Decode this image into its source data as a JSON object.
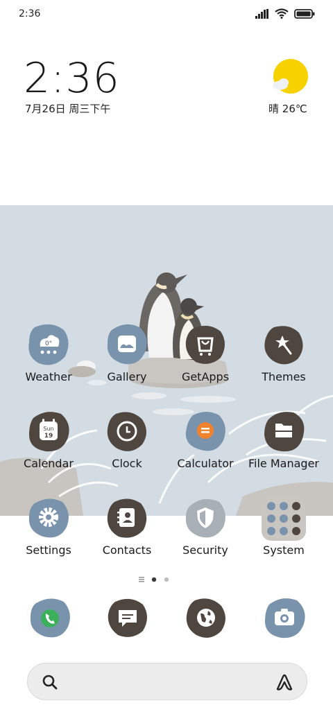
{
  "status_bar": {
    "time": "2:36"
  },
  "clock_widget": {
    "time": "2:36",
    "date": "7月26日 周三下午"
  },
  "weather_widget": {
    "condition": "晴",
    "temperature": "26℃",
    "icon": "sun-with-cloud-icon"
  },
  "apps": [
    {
      "label": "Weather",
      "icon": "cloud-snow-icon",
      "color": "#7a93ad"
    },
    {
      "label": "Gallery",
      "icon": "picture-icon",
      "color": "#7a93ad"
    },
    {
      "label": "GetApps",
      "icon": "shopping-bag-icon",
      "color": "#4f4640"
    },
    {
      "label": "Themes",
      "icon": "star-wand-icon",
      "color": "#4f4640"
    },
    {
      "label": "Calendar",
      "icon": "calendar-icon",
      "color": "#4f4640",
      "calendar_day": "Sun",
      "calendar_date": "19"
    },
    {
      "label": "Clock",
      "icon": "clock-icon",
      "color": "#4f4640"
    },
    {
      "label": "Calculator",
      "icon": "calculator-icon",
      "color": "#7a93ad"
    },
    {
      "label": "File Manager",
      "icon": "folder-icon",
      "color": "#4f4640"
    },
    {
      "label": "Settings",
      "icon": "gear-icon",
      "color": "#7a93ad"
    },
    {
      "label": "Contacts",
      "icon": "contacts-book-icon",
      "color": "#4f4640"
    },
    {
      "label": "Security",
      "icon": "shield-icon",
      "color": "#a8afb6"
    },
    {
      "label": "System",
      "icon": "folder-grid-icon",
      "color": "#c9c6c1"
    }
  ],
  "dock": [
    {
      "name": "phone",
      "icon": "phone-icon",
      "color": "#7a93ad"
    },
    {
      "name": "messages",
      "icon": "message-icon",
      "color": "#4f4640"
    },
    {
      "name": "browser",
      "icon": "globe-icon",
      "color": "#4f4640"
    },
    {
      "name": "camera",
      "icon": "camera-icon",
      "color": "#7a93ad"
    }
  ],
  "pager": {
    "pages": 2,
    "current": 1
  },
  "colors": {
    "wallpaper": "#d3dbe3",
    "accent_orange": "#f0822e",
    "dark_blob": "#4f4640",
    "blue_blob": "#7a93ad"
  }
}
